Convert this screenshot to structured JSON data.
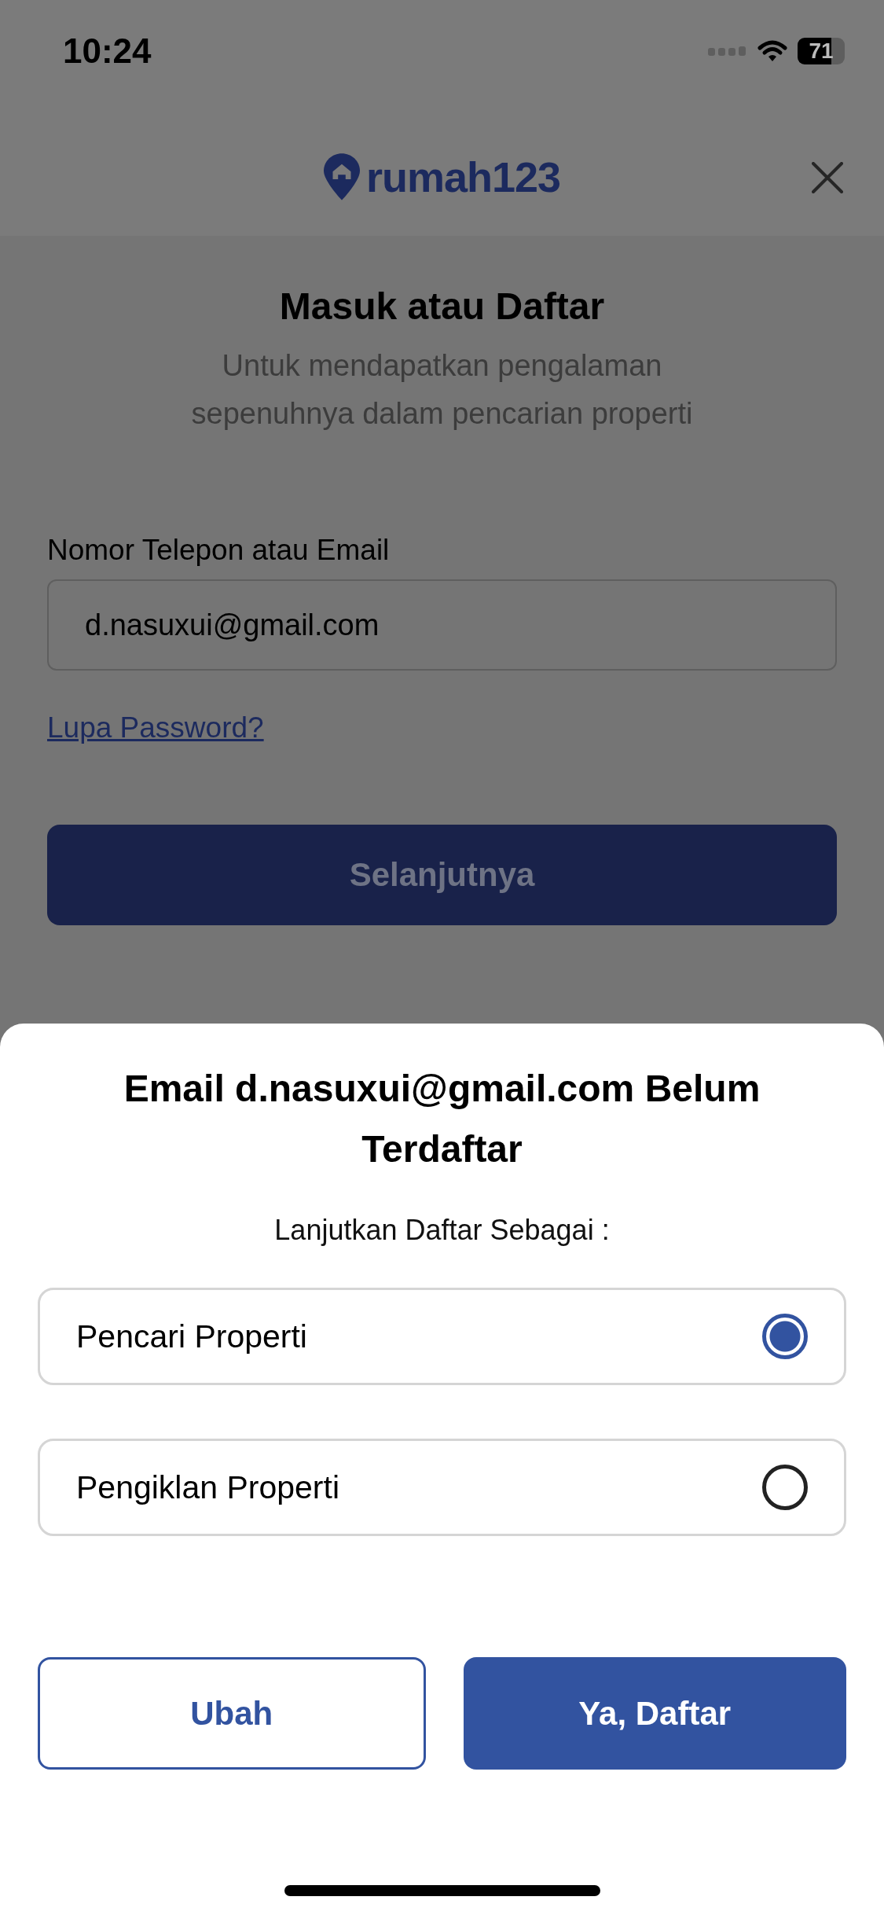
{
  "status_bar": {
    "time": "10:24",
    "battery": "71"
  },
  "header": {
    "logo": "rumah123"
  },
  "login": {
    "title": "Masuk atau Daftar",
    "subtitle": "Untuk mendapatkan pengalaman sepenuhnya dalam pencarian properti",
    "field": {
      "label": "Nomor Telepon atau Email",
      "value": "d.nasuxui@gmail.com"
    },
    "forgot_link": "Lupa Password?",
    "next_button": "Selanjutnya"
  },
  "sheet": {
    "title": "Email d.nasuxui@gmail.com Belum Terdaftar",
    "prompt": "Lanjutkan Daftar Sebagai :",
    "options": [
      {
        "label": "Pencari Properti",
        "selected": true
      },
      {
        "label": "Pengiklan Properti",
        "selected": false
      }
    ],
    "buttons": [
      {
        "label": "Ubah",
        "kind": "outline"
      },
      {
        "label": "Ya, Daftar",
        "kind": "primary"
      }
    ]
  }
}
